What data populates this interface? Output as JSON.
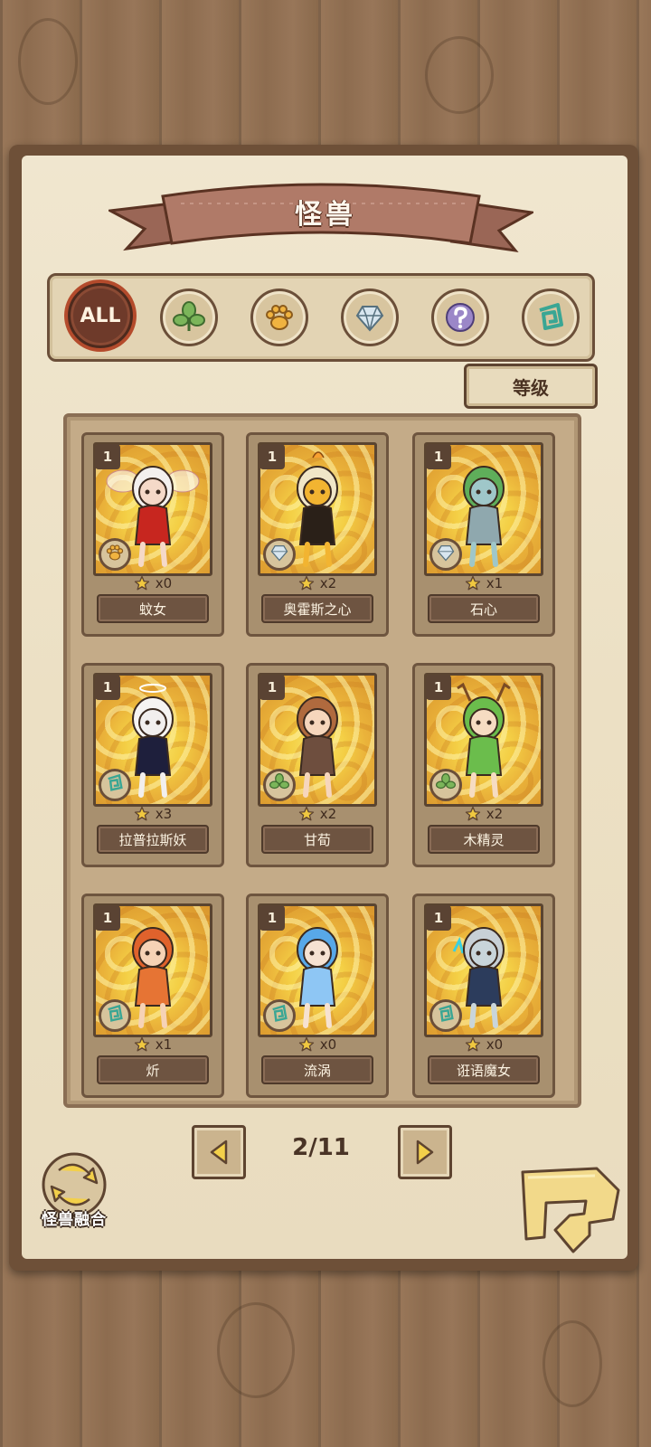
{
  "screen": {
    "title": "怪兽"
  },
  "filters": [
    {
      "id": "all",
      "label": "ALL",
      "icon": "all-icon",
      "active": true
    },
    {
      "id": "plant",
      "icon": "leaf-icon",
      "active": false
    },
    {
      "id": "beast",
      "icon": "paw-icon",
      "active": false
    },
    {
      "id": "mineral",
      "icon": "crystal-icon",
      "active": false
    },
    {
      "id": "unknown",
      "icon": "question-icon",
      "active": false
    },
    {
      "id": "spirit",
      "icon": "spiral-icon",
      "active": false
    }
  ],
  "sort": {
    "label": "等级"
  },
  "cards": [
    {
      "level": "1",
      "count": "x0",
      "name": "蚊女",
      "type_icon": "paw-icon"
    },
    {
      "level": "1",
      "count": "x2",
      "name": "奥霍斯之心",
      "type_icon": "crystal-icon"
    },
    {
      "level": "1",
      "count": "x1",
      "name": "石心",
      "type_icon": "crystal-icon"
    },
    {
      "level": "1",
      "count": "x3",
      "name": "拉普拉斯妖",
      "type_icon": "spiral-icon"
    },
    {
      "level": "1",
      "count": "x2",
      "name": "甘荀",
      "type_icon": "leaf-icon"
    },
    {
      "level": "1",
      "count": "x2",
      "name": "木精灵",
      "type_icon": "leaf-icon"
    },
    {
      "level": "1",
      "count": "x1",
      "name": "炘",
      "type_icon": "spiral-icon"
    },
    {
      "level": "1",
      "count": "x0",
      "name": "流涡",
      "type_icon": "spiral-icon"
    },
    {
      "level": "1",
      "count": "x0",
      "name": "诳语魔女",
      "type_icon": "spiral-icon"
    }
  ],
  "pager": {
    "indicator": "2/11"
  },
  "fusion": {
    "label": "怪兽融合"
  },
  "colors": {
    "ribbon": "#b07a68",
    "paper": "#ece0c4",
    "card_bg": "#f4cf45",
    "plate": "#6e5441"
  }
}
